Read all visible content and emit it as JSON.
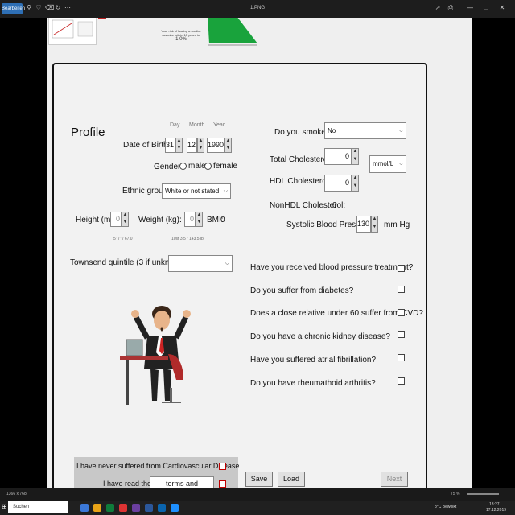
{
  "viewer": {
    "title": "1.PNG",
    "app_button": "Bearbeiten",
    "zoom": "75 %",
    "dimensions": "1366 x 768"
  },
  "taskbar": {
    "search_placeholder": "Suchen",
    "time": "13:27",
    "date": "17.12.2019",
    "weather": "8°C Bewölkt"
  },
  "profile": {
    "heading": "Profile",
    "dob": {
      "label": "Date of Birth",
      "day_caption": "Day",
      "month_caption": "Month",
      "year_caption": "Year",
      "day": "31",
      "month": "12",
      "year": "1990"
    },
    "gender": {
      "label": "Gender:",
      "male": "male",
      "female": "female"
    },
    "ethnic": {
      "label": "Ethnic group",
      "value": "White or not stated"
    },
    "height": {
      "label": "Height (m):",
      "value": "0",
      "conversion": "5' 7\" / 67.0"
    },
    "weight": {
      "label": "Weight (kg):",
      "value": "0",
      "conversion": "10st 3.5 / 143.5 lb"
    },
    "bmi": {
      "label": "BMI:",
      "value": "0"
    },
    "townsend": {
      "label": "Townsend quintile (3 if unknown):",
      "value": ""
    }
  },
  "right": {
    "smoke": {
      "label": "Do you smoke?",
      "value": "No"
    },
    "total_chol": {
      "label": "Total Cholesterol:",
      "value": "0"
    },
    "unit": {
      "value": "mmol/L"
    },
    "hdl_chol": {
      "label": "HDL Cholesterol:",
      "value": "0"
    },
    "nonhdl": {
      "label": "NonHDL Cholesterol:",
      "value": "0"
    },
    "systolic": {
      "label": "Systolic Blood Pressure:",
      "value": "130",
      "unit": "mm Hg"
    }
  },
  "questions": [
    "Have you received blood pressure treatment?",
    "Do you suffer from diabetes?",
    "Does a close relative under 60 suffer from CVD?",
    "Do you have a chronic kidney disease?",
    "Have you suffered atrial fibrillation?",
    "Do you have rheumathoid arthritis?"
  ],
  "footer": {
    "never_cvd": "I have never suffered from Cardiovascular Disease",
    "read_terms": "I have read the",
    "terms_link": "terms and conditions",
    "save": "Save",
    "load": "Load",
    "next": "Next"
  },
  "thumbnail": {
    "caption": "Your risk of having a cardio-vascular within 10 years is:",
    "value": "1.0%"
  },
  "colors": {
    "accent": "#2e6fb5",
    "chart_green": "#19a33c",
    "checkbox_red": "#c00000"
  }
}
